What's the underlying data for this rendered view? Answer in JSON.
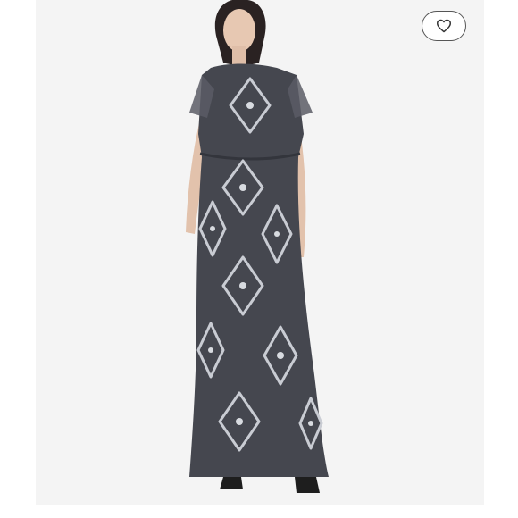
{
  "listing": {
    "photo_subject": "",
    "like_button": {
      "icon": "heart-outline-icon"
    }
  },
  "colors": {
    "background": "#ffffff",
    "photo_backdrop": "#f4f4f4",
    "dress": "#45474f",
    "beading": "#c9ccd3"
  }
}
